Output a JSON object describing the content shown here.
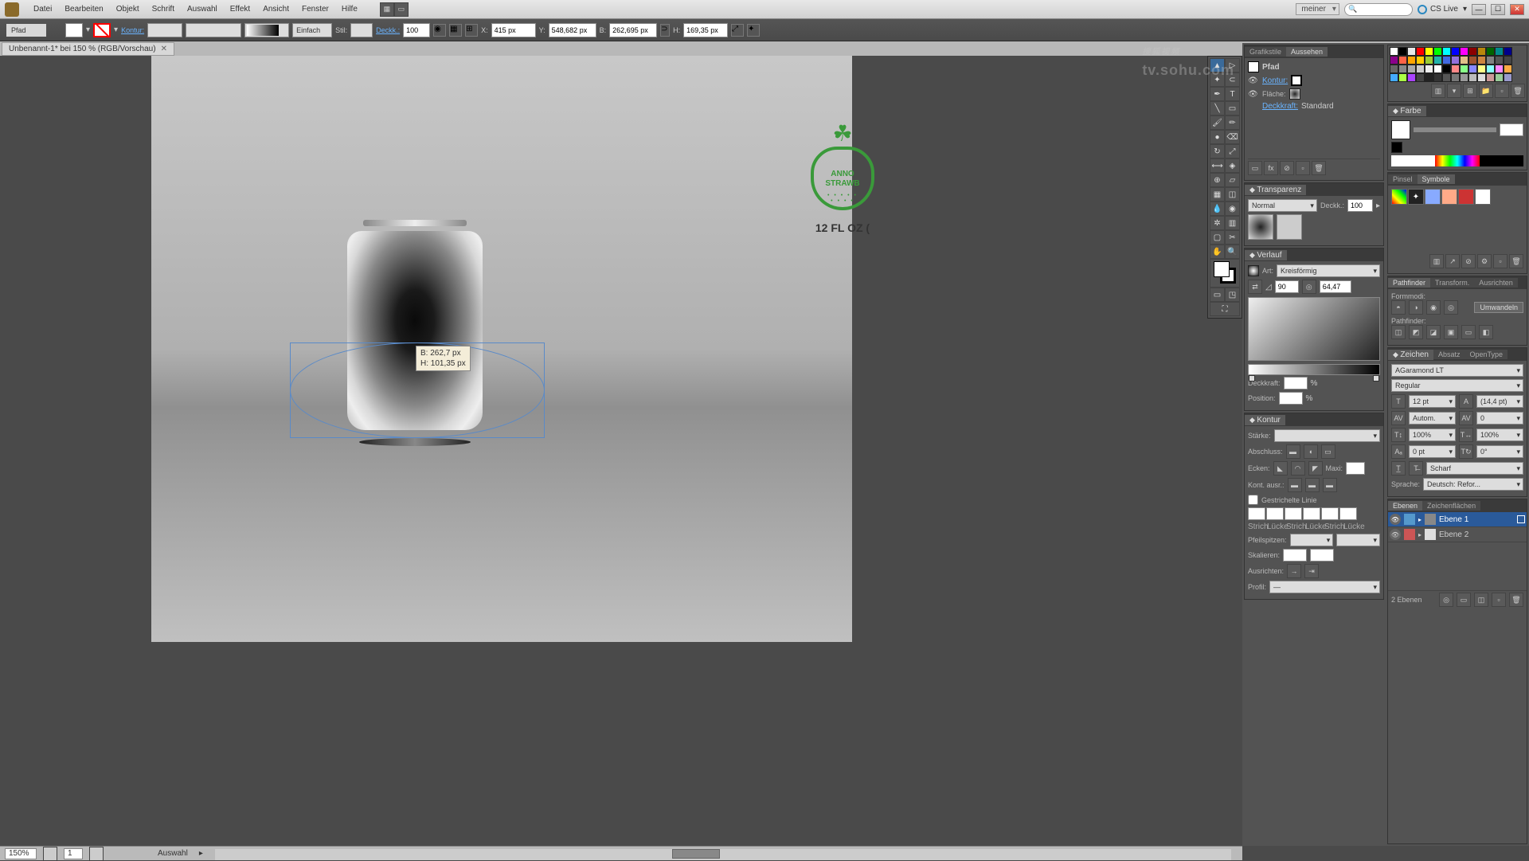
{
  "menubar": {
    "items": [
      "Datei",
      "Bearbeiten",
      "Objekt",
      "Schrift",
      "Auswahl",
      "Effekt",
      "Ansicht",
      "Fenster",
      "Hilfe"
    ],
    "workspace": "meiner",
    "cslive": "CS Live"
  },
  "controlbar": {
    "object_type": "Pfad",
    "kontur_label": "Kontur:",
    "stroke_style": "Einfach",
    "stil_label": "Stil:",
    "deckk_label": "Deckk.:",
    "deckk_value": "100",
    "x_label": "X:",
    "x_value": "415 px",
    "y_label": "Y:",
    "y_value": "548,682 px",
    "b_label": "B:",
    "b_value": "262,695 px",
    "h_label": "H:",
    "h_value": "169,35 px"
  },
  "document": {
    "tab_title": "Unbenannt-1* bei 150 % (RGB/Vorschau)",
    "zoom": "150%",
    "page": "1",
    "status": "Auswahl"
  },
  "canvas": {
    "dim_b": "B: 262,7 px",
    "dim_h": "H: 101,35 px",
    "logo_line1": "ANNO",
    "logo_line2": "STRAWB",
    "floz": "12 FL OZ ("
  },
  "panels": {
    "grafikstile": {
      "tabs": [
        "Grafikstile",
        "Aussehen"
      ],
      "object": "Pfad",
      "kontur": "Kontur:",
      "flache": "Fläche:",
      "deckkraft": "Deckkraft:",
      "deckkraft_value": "Standard"
    },
    "transparenz": {
      "title": "Transparenz",
      "mode": "Normal",
      "deckk_label": "Deckk.:",
      "deckk_value": "100"
    },
    "verlauf": {
      "title": "Verlauf",
      "art_label": "Art:",
      "art_value": "Kreisförmig",
      "angle": "90",
      "ratio": "64,47",
      "deckkraft_label": "Deckkraft:",
      "position_label": "Position:"
    },
    "kontur": {
      "title": "Kontur",
      "starke_label": "Stärke:",
      "abschluss_label": "Abschluss:",
      "ecken_label": "Ecken:",
      "maxi_label": "Maxi:",
      "kont_ausr_label": "Kont. ausr.:",
      "gestrichelte": "Gestrichelte Linie",
      "dash_labels": [
        "Strich",
        "Lücke",
        "Strich",
        "Lücke",
        "Strich",
        "Lücke"
      ],
      "pfeilspitzen_label": "Pfeilspitzen:",
      "skalieren_label": "Skalieren:",
      "ausrichten_label": "Ausrichten:",
      "profil_label": "Profil:"
    },
    "farbe": {
      "title": "Farbe"
    },
    "symbole": {
      "title": "Symbole",
      "tab2": "Pinsel"
    },
    "pathfinder": {
      "tabs": [
        "Pathfinder",
        "Transform.",
        "Ausrichten"
      ],
      "formmodi": "Formmodi:",
      "umwandeln": "Umwandeln",
      "pathfinder_label": "Pathfinder:"
    },
    "zeichen": {
      "tabs": [
        "Zeichen",
        "Absatz",
        "OpenType"
      ],
      "font": "AGaramond LT",
      "style": "Regular",
      "size": "12 pt",
      "leading": "(14,4 pt)",
      "kerning": "Autom.",
      "tracking": "0",
      "hscale": "100%",
      "vscale": "100%",
      "baseline": "0 pt",
      "rotation": "0°",
      "antialiasing": "Scharf",
      "sprache_label": "Sprache:",
      "sprache_value": "Deutsch: Refor..."
    },
    "ebenen": {
      "tabs": [
        "Ebenen",
        "Zeichenflächen"
      ],
      "layer1": "Ebene 1",
      "layer2": "Ebene 2",
      "count": "2 Ebenen"
    }
  },
  "watermark": "搜狐视频",
  "watermark_sub": "tv.sohu.com",
  "swatch_colors": [
    "#ffffff",
    "#000000",
    "#e8e8e8",
    "#ff0000",
    "#ffff00",
    "#00ff00",
    "#00ffff",
    "#0000ff",
    "#ff00ff",
    "#8b0000",
    "#b8860b",
    "#006400",
    "#008b8b",
    "#00008b",
    "#8b008b",
    "#ff6347",
    "#ffa500",
    "#ffcc00",
    "#9acd32",
    "#20b2aa",
    "#4169e1",
    "#9370db",
    "#e0c088",
    "#a0522d",
    "#cd853f",
    "#808080",
    "#555555"
  ]
}
